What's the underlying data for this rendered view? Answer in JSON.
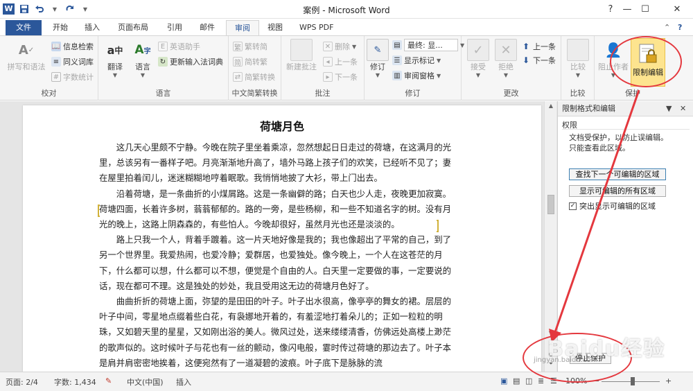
{
  "window": {
    "app_logo": "W",
    "title": "案例 - Microsoft Word",
    "help_label": "?",
    "minimize": "—",
    "maximize": "☐",
    "close": "✕"
  },
  "qat": {
    "save_icon": "floppy-icon",
    "undo_icon": "undo-icon",
    "redo_icon": "redo-icon"
  },
  "tabs": [
    "文件",
    "开始",
    "插入",
    "页面布局",
    "引用",
    "邮件",
    "审阅",
    "视图",
    "WPS PDF"
  ],
  "active_tab": "审阅",
  "ribbon": {
    "proof": {
      "label": "校对",
      "spelling": "拼写和语法",
      "research": "信息检索",
      "thesaurus": "同义词库",
      "wordcount": "字数统计"
    },
    "language": {
      "label": "语言",
      "translate": "翻译",
      "language": "语言",
      "english_helper": "英语助手",
      "update_ime": "更新输入法词典"
    },
    "chinese": {
      "label": "中文简繁转换",
      "to_trad": "繁转简",
      "to_simp": "简转繁",
      "convert": "简繁转换"
    },
    "comments": {
      "label": "批注",
      "new": "新建批注",
      "delete": "删除",
      "prev": "上一条",
      "next": "下一条"
    },
    "tracking": {
      "label": "修订",
      "track": "修订",
      "display_mode": "最终: 显...",
      "show_markup": "显示标记",
      "review_pane": "审阅窗格"
    },
    "changes": {
      "label": "更改",
      "accept": "接受",
      "reject": "拒绝",
      "prev": "上一条",
      "next": "下一条"
    },
    "compare": {
      "label": "比较",
      "compare": "比较"
    },
    "protect": {
      "label": "保护",
      "block_authors": "阻止作者",
      "restrict_editing": "限制编辑"
    }
  },
  "document": {
    "title": "荷塘月色",
    "paragraphs": [
      "这几天心里颇不宁静。今晚在院子里坐着乘凉，忽然想起日日走过的荷塘，在这满月的光里，总该另有一番样子吧。月亮渐渐地升高了，墙外马路上孩子们的欢笑，已经听不见了；妻在屋里拍着闰儿，迷迷糊糊地哼着眠歌。我悄悄地披了大衫，带上门出去。",
      "沿着荷塘，是一条曲折的小煤屑路。这是一条幽僻的路；白天也少人走，夜晚更加寂寞。荷塘四面，长着许多树，蓊蓊郁郁的。路的一旁，是些杨柳，和一些不知道名字的树。没有月光的晚上，这路上阴森森的，有些怕人。今晚却很好，虽然月光也还是淡淡的。",
      "路上只我一个人，背着手踱着。这一片天地好像是我的；我也像超出了平常的自己，到了另一个世界里。我爱热闹，也爱冷静；爱群居，也爱独处。像今晚上，一个人在这苍茫的月下，什么都可以想，什么都可以不想，便觉是个自由的人。白天里一定要做的事，一定要说的话，现在都可不理。这是独处的妙处，我且受用这无边的荷塘月色好了。",
      "曲曲折折的荷塘上面，弥望的是田田的叶子。叶子出水很高，像亭亭的舞女的裙。层层的叶子中间，零星地点缀着些白花，有袅娜地开着的，有羞涩地打着朵儿的；正如一粒粒的明珠，又如碧天里的星星，又如刚出浴的美人。微风过处，送来缕缕清香，仿佛远处高楼上渺茫的歌声似的。这时候叶子与花也有一丝的颤动，像闪电般，霎时传过荷塘的那边去了。叶子本是肩并肩密密地挨着，这便宛然有了一道凝碧的波痕。叶子底下是脉脉的流"
    ]
  },
  "pane": {
    "title": "限制格式和编辑",
    "section": "权限",
    "info_line1": "文档受保护，以防止误编辑。",
    "info_line2": "只能查看此区域。",
    "find_next": "查找下一个可编辑的区域",
    "show_all": "显示可编辑的所有区域",
    "highlight_label": "突出显示可编辑的区域",
    "highlight_checked": "✓",
    "stop_protection": "停止保护"
  },
  "status": {
    "page": "页面: 2/4",
    "words": "字数: 1,434",
    "language": "中文(中国)",
    "mode": "插入",
    "zoom": "100%",
    "zoom_minus": "−",
    "zoom_plus": "+"
  },
  "watermark": {
    "brand": "Baidu经验",
    "url": "jingyan.baidu.com"
  },
  "colors": {
    "accent": "#2b579a",
    "highlight": "#fde48f",
    "annotation": "#e4383e"
  }
}
